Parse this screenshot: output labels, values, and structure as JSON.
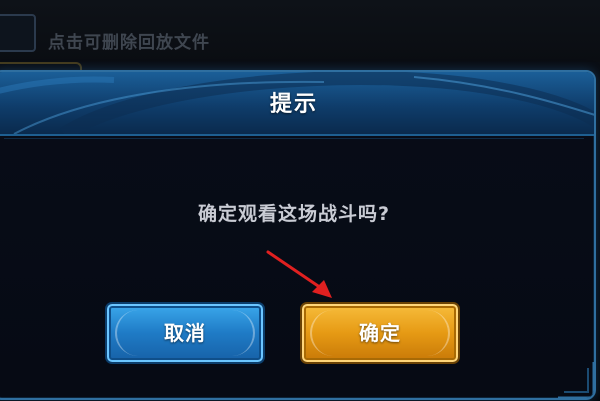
{
  "background": {
    "hint_text": "点击可删除回放文件"
  },
  "modal": {
    "title": "提示",
    "message": "确定观看这场战斗吗?",
    "cancel_label": "取消",
    "confirm_label": "确定"
  },
  "colors": {
    "header_blue": "#1b5f98",
    "cancel_blue": "#2a8fd9",
    "confirm_gold": "#e8a21a",
    "arrow_red": "#e02020"
  },
  "icons": {
    "arrow": "red-arrow-icon"
  }
}
